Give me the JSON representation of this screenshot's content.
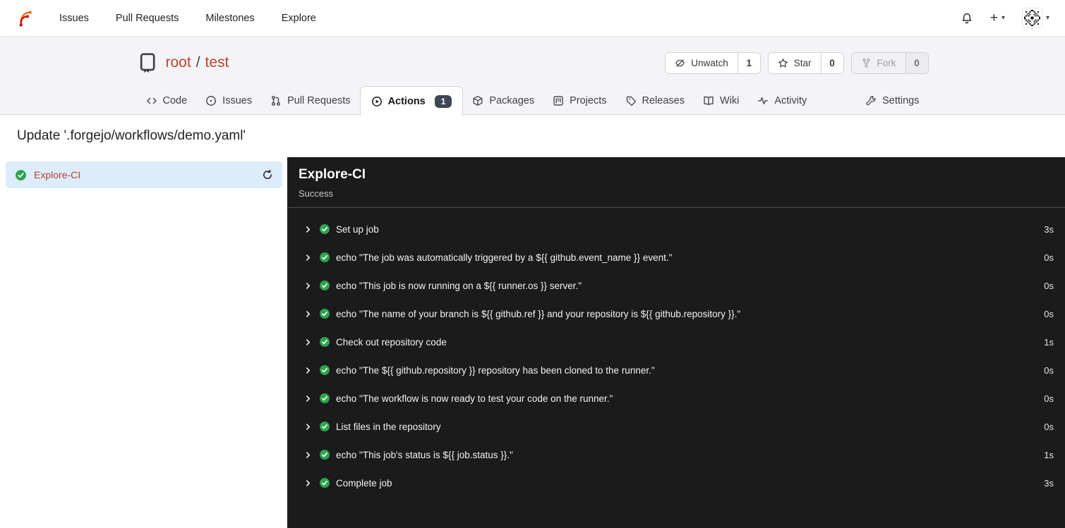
{
  "colors": {
    "accent_link": "#bb432b",
    "panel_bg": "#1b1b1b",
    "selected_row_bg": "#dcecfb",
    "success_green": "#2da44e",
    "badge_bg": "#3f4654",
    "header_bg": "#f4f4f6",
    "logo_orange": "#ff6600",
    "logo_red": "#d40000"
  },
  "icons": {
    "forgejo-logo": "branching circuit glyph",
    "bell-icon": "notification bell",
    "plus-icon": "+",
    "caret-down-icon": "▾",
    "avatar-identicon": "pixel identicon",
    "repo-icon": "book with bookmark",
    "eye-slash-icon": "unwatch eye",
    "star-icon": "star outline",
    "fork-icon": "git fork",
    "code-icon": "angle brackets",
    "issue-icon": "circled dot",
    "pull-request-icon": "git pull request",
    "play-circle-icon": "circled play",
    "package-icon": "cube",
    "project-icon": "board with columns",
    "tag-icon": "tag",
    "book-icon": "open book",
    "pulse-icon": "activity pulse",
    "tools-icon": "wrench",
    "check-circle-icon": "green check circle",
    "refresh-icon": "circular arrow",
    "chevron-right-icon": "›"
  },
  "topnav": {
    "items": [
      {
        "label": "Issues"
      },
      {
        "label": "Pull Requests"
      },
      {
        "label": "Milestones"
      },
      {
        "label": "Explore"
      }
    ]
  },
  "repo": {
    "owner": "root",
    "separator": "/",
    "name": "test",
    "actions": [
      {
        "label": "Unwatch",
        "count": "1"
      },
      {
        "label": "Star",
        "count": "0"
      },
      {
        "label": "Fork",
        "count": "0"
      }
    ]
  },
  "tabs": [
    {
      "label": "Code"
    },
    {
      "label": "Issues"
    },
    {
      "label": "Pull Requests"
    },
    {
      "label": "Actions",
      "badge": "1",
      "active": true
    },
    {
      "label": "Packages"
    },
    {
      "label": "Projects"
    },
    {
      "label": "Releases"
    },
    {
      "label": "Wiki"
    },
    {
      "label": "Activity"
    }
  ],
  "settings_tab": {
    "label": "Settings"
  },
  "page": {
    "title": "Update '.forgejo/workflows/demo.yaml'"
  },
  "sidebar": {
    "job": {
      "label": "Explore-CI",
      "status": "success"
    }
  },
  "panel": {
    "title": "Explore-CI",
    "status": "Success",
    "steps": [
      {
        "name": "Set up job",
        "duration": "3s"
      },
      {
        "name": "echo \"The job was automatically triggered by a ${{ github.event_name }} event.\"",
        "duration": "0s"
      },
      {
        "name": "echo \"This job is now running on a ${{ runner.os }} server.\"",
        "duration": "0s"
      },
      {
        "name": "echo \"The name of your branch is ${{ github.ref }} and your repository is ${{ github.repository }}.\"",
        "duration": "0s"
      },
      {
        "name": "Check out repository code",
        "duration": "1s"
      },
      {
        "name": "echo \"The ${{ github.repository }} repository has been cloned to the runner.\"",
        "duration": "0s"
      },
      {
        "name": "echo \"The workflow is now ready to test your code on the runner.\"",
        "duration": "0s"
      },
      {
        "name": "List files in the repository",
        "duration": "0s"
      },
      {
        "name": "echo \"This job's status is ${{ job.status }}.\"",
        "duration": "1s"
      },
      {
        "name": "Complete job",
        "duration": "3s"
      }
    ]
  }
}
